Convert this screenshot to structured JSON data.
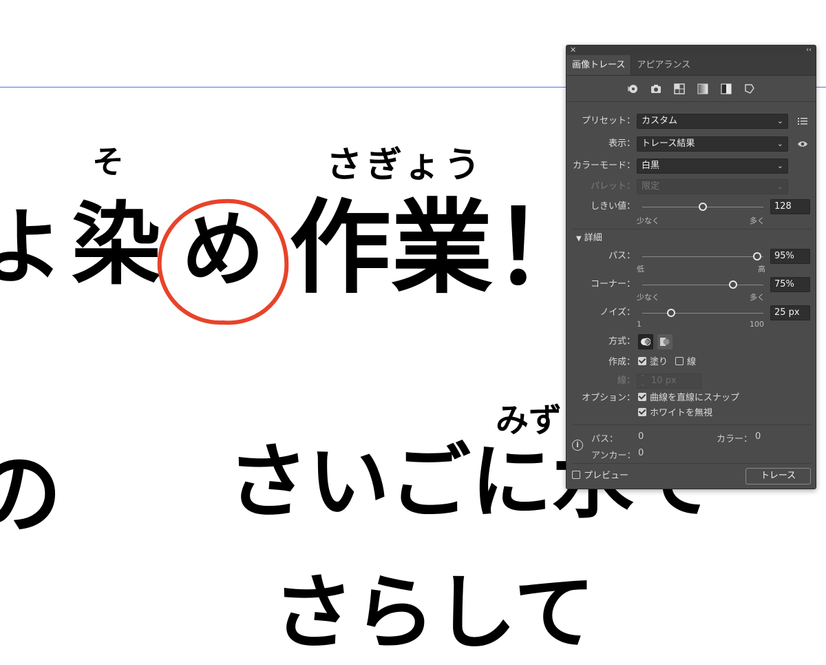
{
  "canvas": {
    "ruby_so": "そ",
    "ruby_sagyou": "さぎょう",
    "line1_yo": "よ",
    "line1_some": "染",
    "line1_me": "め",
    "line1_sagyou": "作業！",
    "line2_left": "の",
    "ruby_mizu": "みず",
    "line2_text": "さいごに水て",
    "line3_text": "さらして",
    "circle_color": "#e8432a",
    "guide_color": "#4a74f5"
  },
  "panel": {
    "close_glyph": "✕",
    "collapse_glyph": "‹‹",
    "tabs": [
      {
        "label": "画像トレース",
        "active": true
      },
      {
        "label": "アピアランス",
        "active": false
      }
    ],
    "preset_icons": [
      "auto-color-icon",
      "high-color-icon",
      "low-color-icon",
      "grayscale-icon",
      "black-white-icon",
      "outline-icon"
    ],
    "preset": {
      "label": "プリセット：",
      "value": "カスタム"
    },
    "view": {
      "label": "表示：",
      "value": "トレース結果"
    },
    "mode": {
      "label": "カラーモード：",
      "value": "白黒"
    },
    "palette": {
      "label": "パレット：",
      "value": "限定"
    },
    "threshold": {
      "label": "しきい値：",
      "value": "128",
      "fraction": 0.5,
      "min_label": "少なく",
      "max_label": "多く"
    },
    "advanced": {
      "label": "詳細"
    },
    "paths": {
      "label": "パス：",
      "value": "95%",
      "fraction": 0.95,
      "min_label": "低",
      "max_label": "高"
    },
    "corners": {
      "label": "コーナー：",
      "value": "75%",
      "fraction": 0.75,
      "min_label": "少なく",
      "max_label": "多く"
    },
    "noise": {
      "label": "ノイズ：",
      "value": "25 px",
      "fraction": 0.24,
      "min_label": "1",
      "max_label": "100"
    },
    "method": {
      "label": "方式："
    },
    "create": {
      "label": "作成：",
      "fills": "塗り",
      "fills_checked": true,
      "strokes": "線",
      "strokes_checked": false
    },
    "stroke": {
      "label": "線：",
      "value": "10 px"
    },
    "options": {
      "label": "オプション：",
      "snap": "曲線を直線にスナップ",
      "snap_checked": true,
      "ignore_white": "ホワイトを無視",
      "ignore_white_checked": true
    },
    "info": {
      "paths_label": "パス：",
      "paths_value": "0",
      "colors_label": "カラー：",
      "colors_value": "0",
      "anchors_label": "アンカー：",
      "anchors_value": "0"
    },
    "preview": {
      "label": "プレビュー",
      "checked": false
    },
    "trace_button": "トレース"
  }
}
